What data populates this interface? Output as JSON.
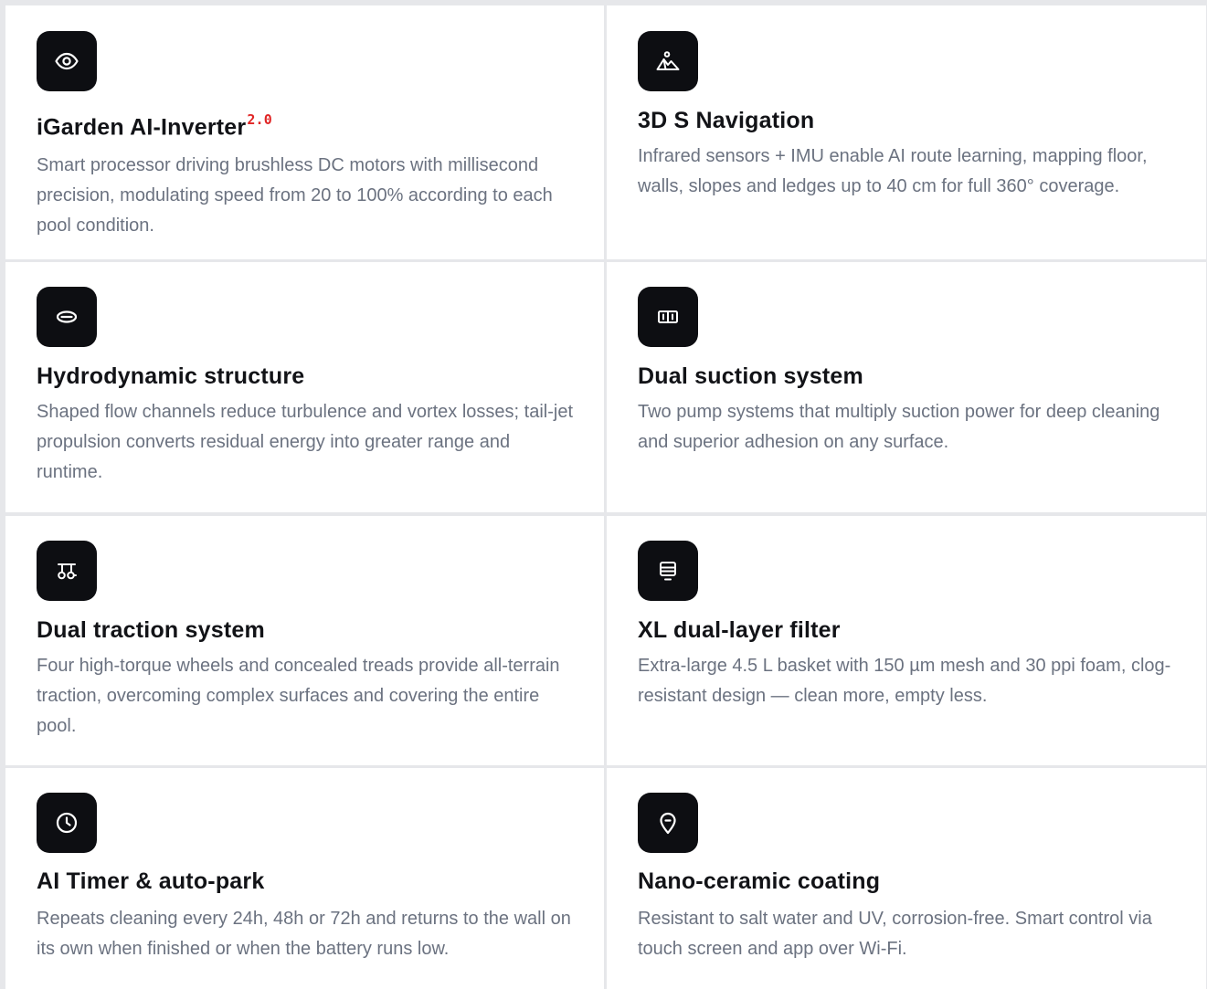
{
  "features": [
    {
      "icon": "eye-icon",
      "title": "iGarden AI-Inverter",
      "title_sup": "2.0",
      "description": "Smart processor driving brushless DC motors with millisecond precision, modulating speed from 20 to 100% according to each pool condition."
    },
    {
      "icon": "mountain-icon",
      "title": "3D S Navigation",
      "description": "Infrared sensors + IMU enable AI route learning, mapping floor, walls, slopes and ledges up to 40 cm for full 360° coverage."
    },
    {
      "icon": "hydrodynamic-icon",
      "title": "Hydrodynamic structure",
      "description": "Shaped flow channels reduce turbulence and vortex losses; tail-jet propulsion converts residual energy into greater range and runtime."
    },
    {
      "icon": "dual-suction-icon",
      "title": "Dual suction system",
      "description": "Two pump systems that multiply suction power for deep cleaning and superior adhesion on any surface."
    },
    {
      "icon": "traction-icon",
      "title": "Dual traction system",
      "description": "Four high-torque wheels and concealed treads provide all-terrain traction, overcoming complex surfaces and covering the entire pool."
    },
    {
      "icon": "filter-icon",
      "title": "XL dual-layer filter",
      "description": "Extra-large 4.5 L basket with 150 µm mesh and 30 ppi foam, clog-resistant design — clean more, empty less."
    },
    {
      "icon": "clock-icon",
      "title": "AI Timer & auto-park",
      "description": "Repeats cleaning every 24h, 48h or 72h and returns to the wall on its own when finished or when the battery runs low."
    },
    {
      "icon": "location-pin-icon",
      "title": "Nano-ceramic coating",
      "description": "Resistant to salt water and UV, corrosion-free. Smart control via touch screen and app over Wi-Fi."
    }
  ]
}
